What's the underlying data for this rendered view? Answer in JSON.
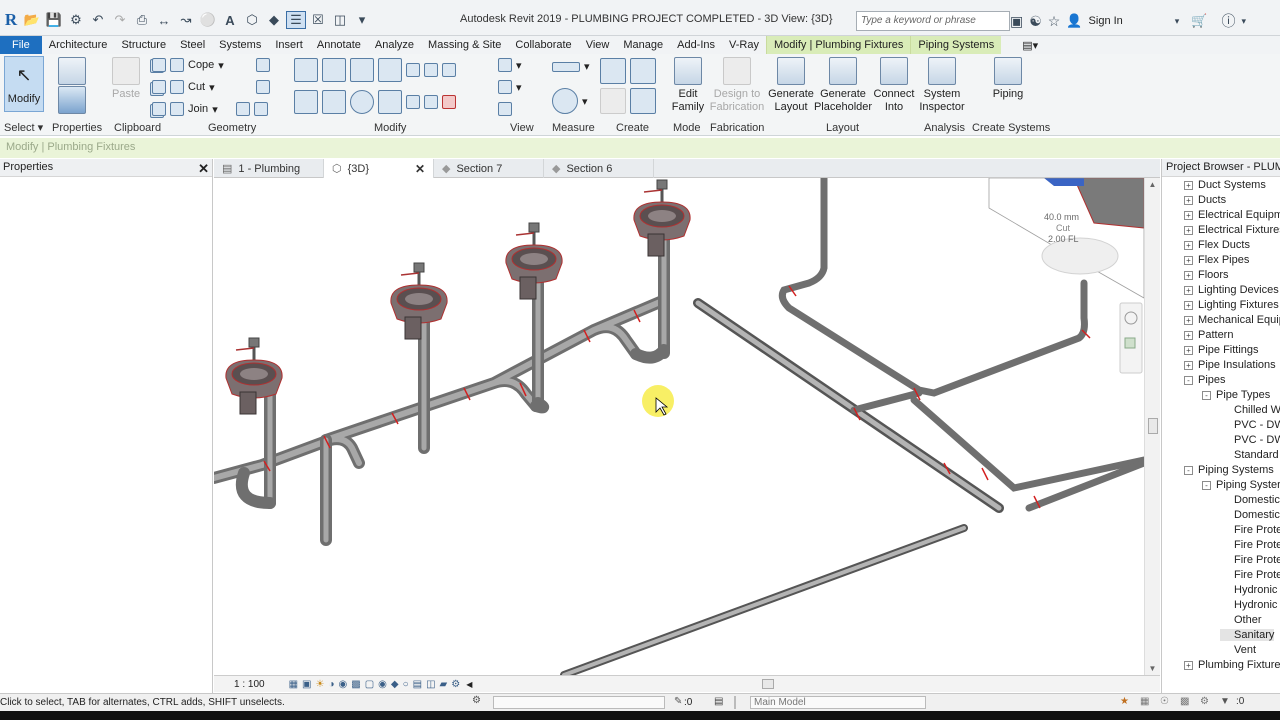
{
  "app": {
    "logo": "R",
    "title": "Autodesk Revit 2019 - PLUMBING PROJECT COMPLETED - 3D View: {3D}",
    "search_placeholder": "Type a keyword or phrase",
    "sign_in": "Sign In"
  },
  "tabs": [
    "File",
    "Architecture",
    "Structure",
    "Steel",
    "Systems",
    "Insert",
    "Annotate",
    "Analyze",
    "Massing & Site",
    "Collaborate",
    "View",
    "Manage",
    "Add-Ins",
    "V-Ray",
    "Modify | Plumbing Fixtures",
    "Piping Systems"
  ],
  "ribbon": {
    "modify_label": "Modify",
    "select_label": "Select",
    "properties_label": "Properties",
    "paste_label": "Paste",
    "clipboard_label": "Clipboard",
    "cope": "Cope",
    "cut": "Cut",
    "join": "Join",
    "geometry_label": "Geometry",
    "modify_group_label": "Modify",
    "view_label": "View",
    "measure_label": "Measure",
    "create_label": "Create",
    "edit_family": "Edit Family",
    "mode_label": "Mode",
    "design_fab": "Design to Fabrication",
    "fabrication_label": "Fabrication",
    "gen_layout": "Generate Layout",
    "gen_placeholder": "Generate Placeholder",
    "connect_into": "Connect Into",
    "layout_label": "Layout",
    "system_inspector": "System Inspector",
    "analysis_label": "Analysis",
    "piping": "Piping",
    "create_systems_label": "Create Systems"
  },
  "context_bar": "Modify | Plumbing Fixtures",
  "properties": {
    "title": "Properties"
  },
  "view_tabs": [
    {
      "label": "1 - Plumbing"
    },
    {
      "label": "{3D}"
    },
    {
      "label": "Section 7"
    },
    {
      "label": "Section 6"
    }
  ],
  "viewcube": {
    "line1": "40.0 mm",
    "line2": "Cut",
    "line3": "2.00 FL"
  },
  "scale": "1 : 100",
  "browser": {
    "title": "Project Browser - PLUMBI",
    "items": [
      "Duct Systems",
      "Ducts",
      "Electrical Equipm",
      "Electrical Fixtures",
      "Flex Ducts",
      "Flex Pipes",
      "Floors",
      "Lighting Devices",
      "Lighting Fixtures",
      "Mechanical Equip",
      "Pattern",
      "Pipe Fittings",
      "Pipe Insulations",
      "Pipes",
      "Pipe Types",
      "Chilled W",
      "PVC - DW",
      "PVC - DW",
      "Standard",
      "Piping Systems",
      "Piping Syster",
      "Domestic",
      "Domestic",
      "Fire Prote",
      "Fire Prote",
      "Fire Prote",
      "Fire Prote",
      "Hydronic",
      "Hydronic",
      "Other",
      "Sanitary",
      "Vent",
      "Plumbing Fixture"
    ]
  },
  "status": {
    "hint": "Click to select, TAB for alternates, CTRL adds, SHIFT unselects.",
    "zero": ":0",
    "model": "Main Model"
  }
}
